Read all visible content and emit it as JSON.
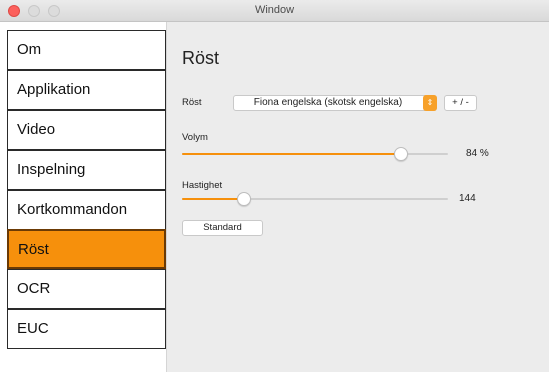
{
  "window": {
    "title": "Window"
  },
  "sidebar": {
    "items": [
      {
        "label": "Om"
      },
      {
        "label": "Applikation"
      },
      {
        "label": "Video"
      },
      {
        "label": "Inspelning"
      },
      {
        "label": "Kortkommandon"
      },
      {
        "label": "Röst",
        "active": true
      },
      {
        "label": "OCR"
      },
      {
        "label": "EUC"
      }
    ]
  },
  "main": {
    "title": "Röst",
    "voice": {
      "label": "Röst",
      "selected": "Fiona engelska (skotsk engelska)",
      "plus_minus_label": "+ / -"
    },
    "volume": {
      "label": "Volym",
      "value": 84,
      "display": "84 %"
    },
    "speed": {
      "label": "Hastighet",
      "display": "144",
      "fill_fraction": 0.22
    },
    "standard_label": "Standard"
  },
  "colors": {
    "accent": "#f6900c",
    "active_border": "#6b3a04"
  }
}
